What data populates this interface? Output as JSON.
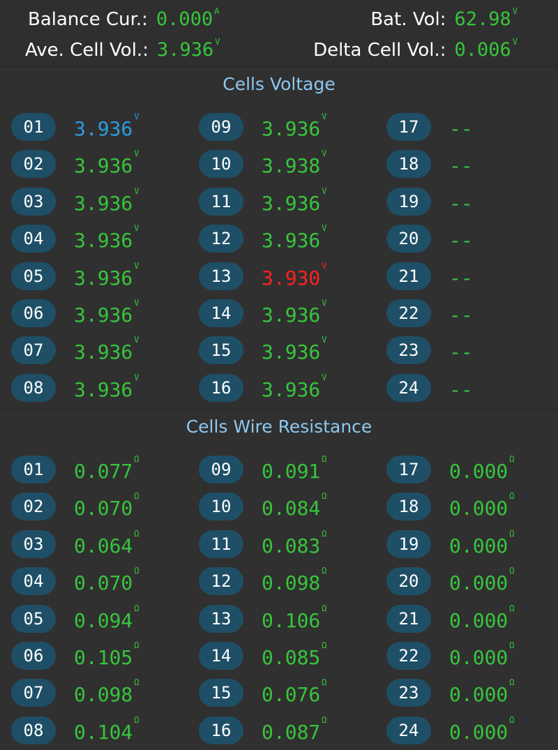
{
  "summary": {
    "balance_cur": {
      "label": "Balance Cur.:",
      "value": "0.000",
      "unit": "A"
    },
    "bat_vol": {
      "label": "Bat. Vol:",
      "value": "62.98",
      "unit": "V"
    },
    "ave_cell_vol": {
      "label": "Ave. Cell Vol.:",
      "value": "3.936",
      "unit": "V"
    },
    "delta_cell_vol": {
      "label": "Delta Cell Vol.:",
      "value": "0.006",
      "unit": "V"
    }
  },
  "colors": {
    "normal": "#37c53c",
    "max": "#2a9de0",
    "min": "#ff2020",
    "badge": "#1f4f66",
    "title": "#8ec7f0"
  },
  "voltage": {
    "title": "Cells Voltage",
    "cells": [
      {
        "id": "01",
        "value": "3.936",
        "unit": "V",
        "status": "max"
      },
      {
        "id": "02",
        "value": "3.936",
        "unit": "V",
        "status": "normal"
      },
      {
        "id": "03",
        "value": "3.936",
        "unit": "V",
        "status": "normal"
      },
      {
        "id": "04",
        "value": "3.936",
        "unit": "V",
        "status": "normal"
      },
      {
        "id": "05",
        "value": "3.936",
        "unit": "V",
        "status": "normal"
      },
      {
        "id": "06",
        "value": "3.936",
        "unit": "V",
        "status": "normal"
      },
      {
        "id": "07",
        "value": "3.936",
        "unit": "V",
        "status": "normal"
      },
      {
        "id": "08",
        "value": "3.936",
        "unit": "V",
        "status": "normal"
      },
      {
        "id": "09",
        "value": "3.936",
        "unit": "V",
        "status": "normal"
      },
      {
        "id": "10",
        "value": "3.938",
        "unit": "V",
        "status": "normal"
      },
      {
        "id": "11",
        "value": "3.936",
        "unit": "V",
        "status": "normal"
      },
      {
        "id": "12",
        "value": "3.936",
        "unit": "V",
        "status": "normal"
      },
      {
        "id": "13",
        "value": "3.930",
        "unit": "V",
        "status": "min"
      },
      {
        "id": "14",
        "value": "3.936",
        "unit": "V",
        "status": "normal"
      },
      {
        "id": "15",
        "value": "3.936",
        "unit": "V",
        "status": "normal"
      },
      {
        "id": "16",
        "value": "3.936",
        "unit": "V",
        "status": "normal"
      },
      {
        "id": "17",
        "value": "--",
        "unit": "",
        "status": "normal"
      },
      {
        "id": "18",
        "value": "--",
        "unit": "",
        "status": "normal"
      },
      {
        "id": "19",
        "value": "--",
        "unit": "",
        "status": "normal"
      },
      {
        "id": "20",
        "value": "--",
        "unit": "",
        "status": "normal"
      },
      {
        "id": "21",
        "value": "--",
        "unit": "",
        "status": "normal"
      },
      {
        "id": "22",
        "value": "--",
        "unit": "",
        "status": "normal"
      },
      {
        "id": "23",
        "value": "--",
        "unit": "",
        "status": "normal"
      },
      {
        "id": "24",
        "value": "--",
        "unit": "",
        "status": "normal"
      }
    ]
  },
  "resistance": {
    "title": "Cells Wire Resistance",
    "cells": [
      {
        "id": "01",
        "value": "0.077",
        "unit": "Ω",
        "status": "normal"
      },
      {
        "id": "02",
        "value": "0.070",
        "unit": "Ω",
        "status": "normal"
      },
      {
        "id": "03",
        "value": "0.064",
        "unit": "Ω",
        "status": "normal"
      },
      {
        "id": "04",
        "value": "0.070",
        "unit": "Ω",
        "status": "normal"
      },
      {
        "id": "05",
        "value": "0.094",
        "unit": "Ω",
        "status": "normal"
      },
      {
        "id": "06",
        "value": "0.105",
        "unit": "Ω",
        "status": "normal"
      },
      {
        "id": "07",
        "value": "0.098",
        "unit": "Ω",
        "status": "normal"
      },
      {
        "id": "08",
        "value": "0.104",
        "unit": "Ω",
        "status": "normal"
      },
      {
        "id": "09",
        "value": "0.091",
        "unit": "Ω",
        "status": "normal"
      },
      {
        "id": "10",
        "value": "0.084",
        "unit": "Ω",
        "status": "normal"
      },
      {
        "id": "11",
        "value": "0.083",
        "unit": "Ω",
        "status": "normal"
      },
      {
        "id": "12",
        "value": "0.098",
        "unit": "Ω",
        "status": "normal"
      },
      {
        "id": "13",
        "value": "0.106",
        "unit": "Ω",
        "status": "normal"
      },
      {
        "id": "14",
        "value": "0.085",
        "unit": "Ω",
        "status": "normal"
      },
      {
        "id": "15",
        "value": "0.076",
        "unit": "Ω",
        "status": "normal"
      },
      {
        "id": "16",
        "value": "0.087",
        "unit": "Ω",
        "status": "normal"
      },
      {
        "id": "17",
        "value": "0.000",
        "unit": "Ω",
        "status": "normal"
      },
      {
        "id": "18",
        "value": "0.000",
        "unit": "Ω",
        "status": "normal"
      },
      {
        "id": "19",
        "value": "0.000",
        "unit": "Ω",
        "status": "normal"
      },
      {
        "id": "20",
        "value": "0.000",
        "unit": "Ω",
        "status": "normal"
      },
      {
        "id": "21",
        "value": "0.000",
        "unit": "Ω",
        "status": "normal"
      },
      {
        "id": "22",
        "value": "0.000",
        "unit": "Ω",
        "status": "normal"
      },
      {
        "id": "23",
        "value": "0.000",
        "unit": "Ω",
        "status": "normal"
      },
      {
        "id": "24",
        "value": "0.000",
        "unit": "Ω",
        "status": "normal"
      }
    ]
  }
}
